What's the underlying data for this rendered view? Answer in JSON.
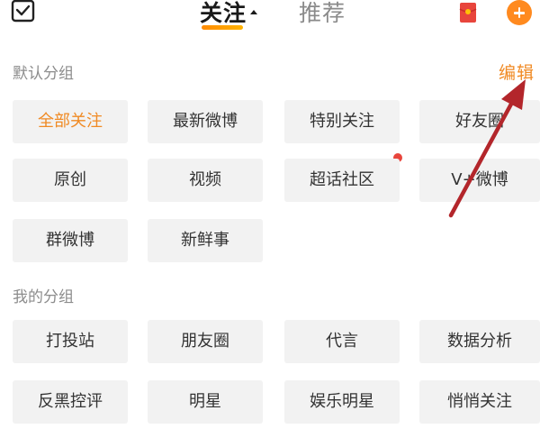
{
  "header": {
    "tabs": [
      {
        "label": "关注",
        "active": true
      },
      {
        "label": "推荐",
        "active": false
      }
    ],
    "icons": [
      "checkin-icon",
      "red-packet-icon",
      "add-icon"
    ]
  },
  "sections": {
    "default": {
      "title": "默认分组",
      "edit_label": "编辑",
      "chips": [
        "全部关注",
        "最新微博",
        "特别关注",
        "好友圈",
        "原创",
        "视频",
        "超话社区",
        "V+微博",
        "群微博",
        "新鲜事"
      ]
    },
    "mine": {
      "title": "我的分组",
      "chips": [
        "打投站",
        "朋友圈",
        "代言",
        "数据分析",
        "反黑控评",
        "明星",
        "娱乐明星",
        "悄悄关注"
      ]
    }
  },
  "colors": {
    "accent": "#f08a24",
    "chip_bg": "#f2f2f2",
    "arrow": "#b3262b",
    "badge": "#e8453c"
  }
}
